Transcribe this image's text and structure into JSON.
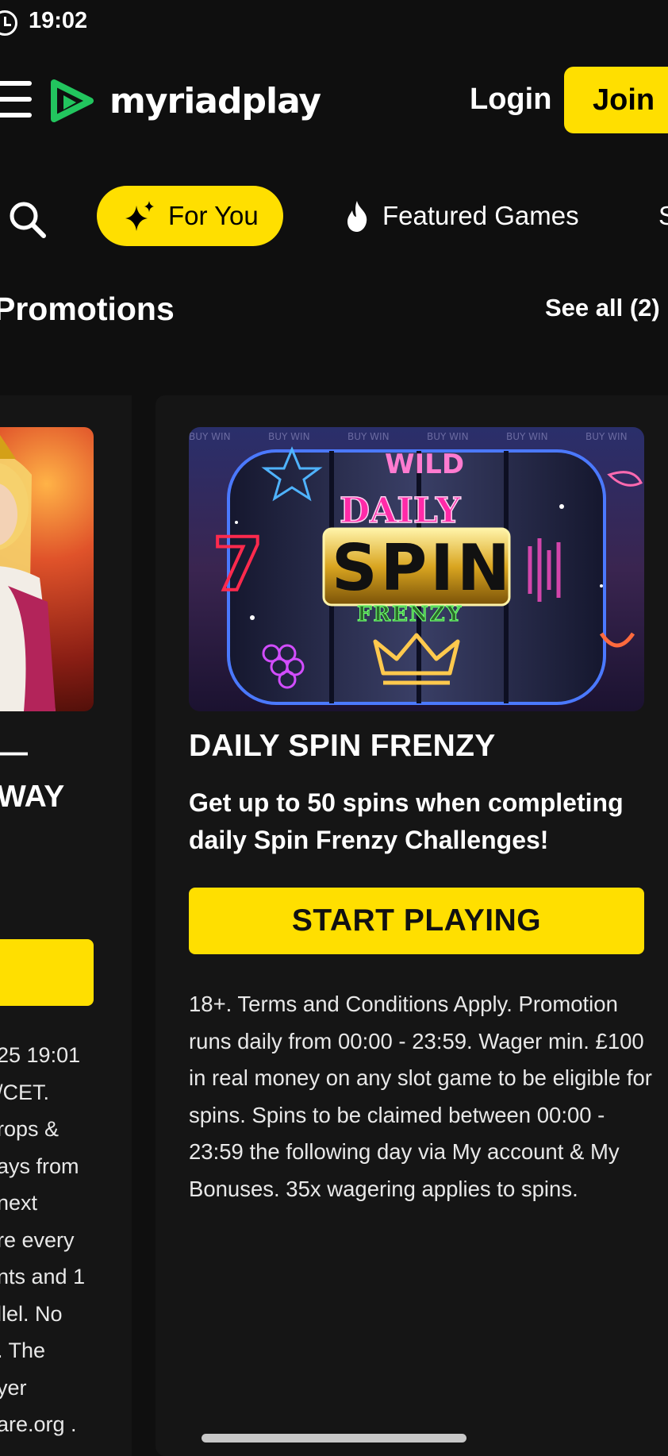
{
  "status_bar": {
    "time": "19:02"
  },
  "header": {
    "brand": "myriadplay",
    "login_label": "Login",
    "join_label": "Join"
  },
  "nav": {
    "items": [
      {
        "label": "For You",
        "icon": "sparkle-icon",
        "active": true
      },
      {
        "label": "Featured Games",
        "icon": "flame-icon",
        "active": false
      },
      {
        "label": "S",
        "icon": "",
        "active": false
      }
    ]
  },
  "section": {
    "title": "Promotions",
    "see_all_label": "See all (2)"
  },
  "promo_left": {
    "title_lines": [
      "—",
      "WAY"
    ],
    "terms_lines": [
      "25 19:01",
      "/CET.",
      "rops &",
      "ays from",
      "next",
      "re every",
      "nts and 1",
      "llel. No",
      ". The",
      "yer",
      "are.org ."
    ]
  },
  "promo_main": {
    "image_text": {
      "top": "WILD",
      "daily": "DAILY",
      "spin": "SPIN",
      "frenzy": "FRENZY",
      "watermark": "BUY WIN"
    },
    "title": "DAILY SPIN FRENZY",
    "description": "Get up to 50 spins when completing daily Spin Frenzy Challenges!",
    "cta_label": "START PLAYING",
    "terms": "18+. Terms and Conditions Apply. Promotion runs daily from 00:00 - 23:59. Wager min. £100 in real money on any slot game to be eligible for spins. Spins to be claimed between 00:00 - 23:59 the following day via My account & My Bonuses. 35x wagering applies to spins."
  },
  "colors": {
    "accent": "#ffdf00",
    "background": "#0f0f0f",
    "card": "#151515",
    "logo_green": "#22c55e"
  }
}
